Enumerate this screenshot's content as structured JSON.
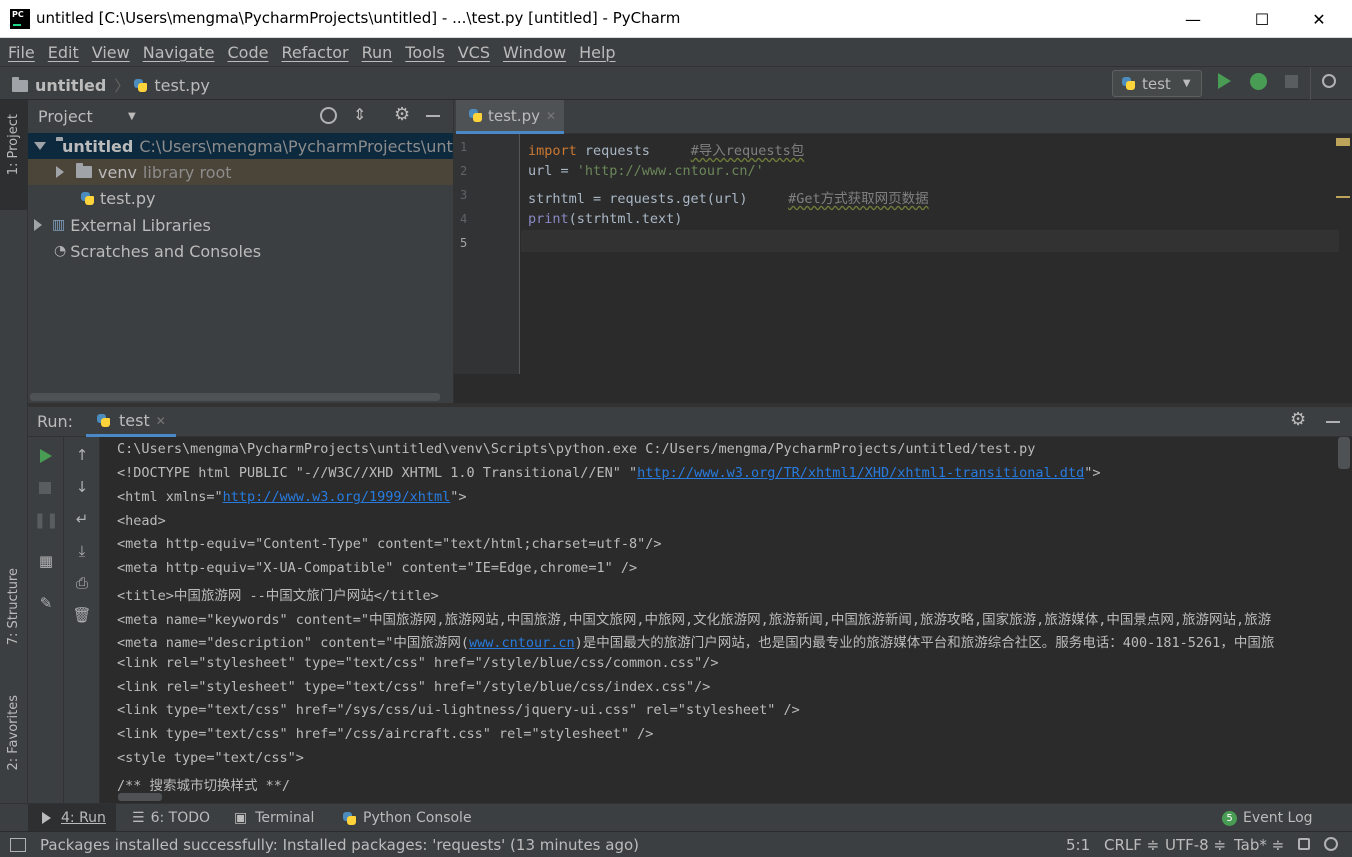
{
  "window": {
    "title": "untitled [C:\\Users\\mengma\\PycharmProjects\\untitled] - ...\\test.py [untitled] - PyCharm",
    "logo_text": "PC",
    "minimize": "—",
    "maximize": "☐",
    "close": "✕"
  },
  "menu": [
    "File",
    "Edit",
    "View",
    "Navigate",
    "Code",
    "Refactor",
    "Run",
    "Tools",
    "VCS",
    "Window",
    "Help"
  ],
  "navbar": {
    "project": "untitled",
    "file": "test.py",
    "run_config": "test"
  },
  "left_strip": {
    "project_tab": "1: Project",
    "structure_tab": "7: Structure",
    "favorites_tab": "2: Favorites"
  },
  "project_panel": {
    "title": "Project",
    "tree": {
      "root_name": "untitled",
      "root_path": "C:\\Users\\mengma\\PycharmProjects\\untitled",
      "venv": "venv",
      "venv_note": "library root",
      "file": "test.py",
      "external": "External Libraries",
      "scratches": "Scratches and Consoles"
    }
  },
  "editor": {
    "tab": "test.py",
    "line_numbers": [
      "1",
      "2",
      "3",
      "4",
      "5"
    ],
    "lines": [
      {
        "kw": "import",
        "text": " requests",
        "comment": "#导入requests包"
      },
      {
        "text": "url = ",
        "str": "'http://www.cntour.cn/'"
      },
      {
        "text": "strhtml = requests.get(url)",
        "comment": "#Get方式获取网页数据"
      },
      {
        "bi": "print",
        "text": "(strhtml.text)"
      }
    ]
  },
  "run_panel": {
    "label": "Run:",
    "tab": "test",
    "console_lines": [
      "C:\\Users\\mengma\\PycharmProjects\\untitled\\venv\\Scripts\\python.exe C:/Users/mengma/PycharmProjects/untitled/test.py",
      "<!DOCTYPE html PUBLIC \"-//W3C//XHD XHTML 1.0 Transitional//EN\" \"",
      "http://www.w3.org/TR/xhtml1/XHD/xhtml1-transitional.dtd",
      "\">",
      "<html xmlns=\"",
      "http://www.w3.org/1999/xhtml",
      "\">",
      "<head>",
      "<meta http-equiv=\"Content-Type\" content=\"text/html;charset=utf-8\"/>",
      "<meta http-equiv=\"X-UA-Compatible\" content=\"IE=Edge,chrome=1\" />",
      "<title>中国旅游网 --中国文旅门户网站</title>",
      "<meta name=\"keywords\" content=\"中国旅游网,旅游网站,中国旅游,中国文旅网,中旅网,文化旅游网,旅游新闻,中国旅游新闻,旅游攻略,国家旅游,旅游媒体,中国景点网,旅游网站,旅游",
      "<meta name=\"description\" content=\"中国旅游网(",
      "www.cntour.cn",
      ")是中国最大的旅游门户网站，也是国内最专业的旅游媒体平台和旅游综合社区。服务电话：400-181-5261，中国旅",
      "<link rel=\"stylesheet\" type=\"text/css\" href=\"/style/blue/css/common.css\"/>",
      "<link rel=\"stylesheet\" type=\"text/css\" href=\"/style/blue/css/index.css\"/>",
      "<link type=\"text/css\" href=\"/sys/css/ui-lightness/jquery-ui.css\" rel=\"stylesheet\" />",
      "<link type=\"text/css\" href=\"/css/aircraft.css\" rel=\"stylesheet\" />",
      "<style type=\"text/css\">",
      "/** 搜索城市切换样式 **/"
    ]
  },
  "bottom_tabs": {
    "run": "4: Run",
    "todo": "6: TODO",
    "terminal": "Terminal",
    "python_console": "Python Console",
    "event_log_count": "5",
    "event_log": "Event Log"
  },
  "status": {
    "message": "Packages installed successfully: Installed packages: 'requests' (13 minutes ago)",
    "position": "5:1",
    "line_sep": "CRLF ≑",
    "encoding": "UTF-8 ≑",
    "indent": "Tab* ≑"
  },
  "colors": {
    "accent": "#4a88c7",
    "run_green": "#499c54",
    "keyword": "#cc7832",
    "string": "#6a8759",
    "comment": "#808080",
    "link": "#287bde"
  }
}
